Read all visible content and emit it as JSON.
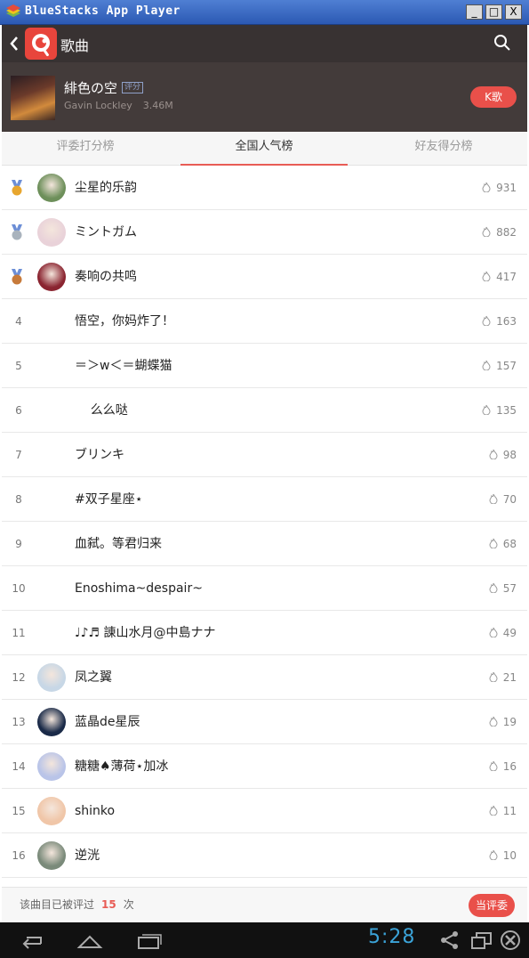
{
  "window": {
    "title": "BlueStacks App Player",
    "minimize": "_",
    "maximize": "□",
    "close": "X"
  },
  "header": {
    "title": "歌曲"
  },
  "song": {
    "title": "緋色の空",
    "rate_tag": "评分",
    "artist": "Gavin Lockley",
    "plays": "3.46M",
    "kge_label": "K歌"
  },
  "tabs": [
    {
      "label": "评委打分榜",
      "active": false
    },
    {
      "label": "全国人气榜",
      "active": true
    },
    {
      "label": "好友得分榜",
      "active": false
    }
  ],
  "rows": [
    {
      "rank": "",
      "medal": "gold",
      "avatar": true,
      "name": "尘星的乐韵",
      "score": "931"
    },
    {
      "rank": "",
      "medal": "silver",
      "avatar": true,
      "name": "ミントガム",
      "score": "882"
    },
    {
      "rank": "",
      "medal": "bronze",
      "avatar": true,
      "name": "奏响の共鸣",
      "score": "417"
    },
    {
      "rank": "4",
      "medal": "",
      "avatar": false,
      "name": "悟空，你妈炸了！",
      "score": "163"
    },
    {
      "rank": "5",
      "medal": "",
      "avatar": false,
      "name": "＝＞w＜＝蝴蝶猫",
      "score": "157"
    },
    {
      "rank": "6",
      "medal": "",
      "avatar": false,
      "name": "    么么哒",
      "score": "135"
    },
    {
      "rank": "7",
      "medal": "",
      "avatar": false,
      "name": "ブリンキ",
      "score": "98"
    },
    {
      "rank": "8",
      "medal": "",
      "avatar": false,
      "name": "#双子星座⋆",
      "score": "70"
    },
    {
      "rank": "9",
      "medal": "",
      "avatar": false,
      "name": "血弑。等君归来",
      "score": "68"
    },
    {
      "rank": "10",
      "medal": "",
      "avatar": false,
      "name": "Enoshima~despair~",
      "score": "57"
    },
    {
      "rank": "11",
      "medal": "",
      "avatar": false,
      "name": "♩♪♬ 諌山水月@中島ナナ",
      "score": "49"
    },
    {
      "rank": "12",
      "medal": "",
      "avatar": true,
      "name": "凤之翼",
      "score": "21"
    },
    {
      "rank": "13",
      "medal": "",
      "avatar": true,
      "name": "蓝晶de星辰",
      "score": "19"
    },
    {
      "rank": "14",
      "medal": "",
      "avatar": true,
      "name": "糖糖♠薄荷⋆加冰",
      "score": "16"
    },
    {
      "rank": "15",
      "medal": "",
      "avatar": true,
      "name": "shinko",
      "score": "11"
    },
    {
      "rank": "16",
      "medal": "",
      "avatar": true,
      "name": "逆洸",
      "score": "10"
    }
  ],
  "footer": {
    "text_before": "该曲目已被评过",
    "count": "15",
    "text_after": "次",
    "judge_label": "当评委"
  },
  "system": {
    "clock": "5:28"
  },
  "colors": {
    "accent": "#e9504a",
    "header_bg": "#383232",
    "clock": "#3ba3d8"
  }
}
